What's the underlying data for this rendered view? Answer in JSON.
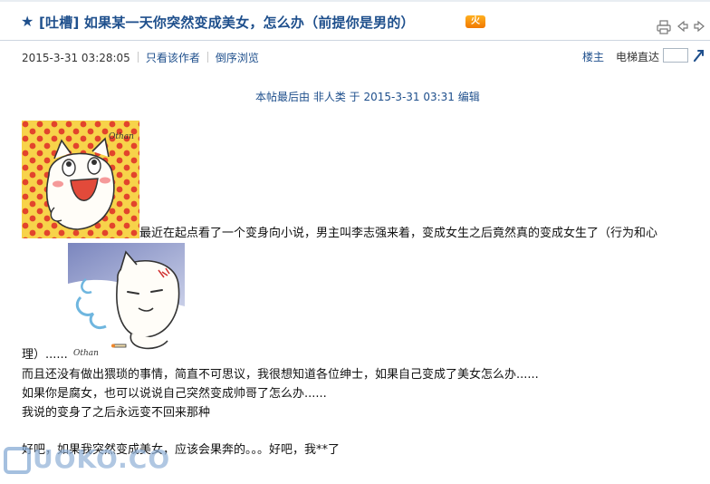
{
  "thread": {
    "title": "[吐槽] 如果某一天你突然变成美女，怎么办（前提你是男的）",
    "hot_badge": "火"
  },
  "toolbar": {
    "print_icon": "print-icon",
    "prev_icon": "arrow-left-icon",
    "next_icon": "arrow-right-icon"
  },
  "post_meta": {
    "timestamp": "2015-3-31 03:28:05",
    "only_author": "只看该作者",
    "reverse_view": "倒序浏览",
    "floor_label": "楼主",
    "jump_label": "电梯直达",
    "jump_value": ""
  },
  "edit_note": "本帖最后由 非人类 于 2015-3-31 03:31 编辑",
  "content": {
    "line1": "最近在起点看了一个变身向小说，男主叫李志强来着，变成女生之后竟然真的变成女生了（行为和心",
    "line2": "理）......",
    "line3": "而且还没有做出猥琐的事情，简直不可思议，我很想知道各位绅士，如果自己变成了美女怎么办......",
    "line4": "如果你是腐女，也可以说说自己突然变成帅哥了怎么办......",
    "line5": "我说的变身了之后永远变不回来那种",
    "line6": "好吧，如果我突然变成美女，应该会果奔的。。。好吧，我**了"
  },
  "images": {
    "emoji1_signature": "Othan",
    "emoji2_signature": "Othan"
  },
  "watermark": "UOKO.CO",
  "colors": {
    "link": "#1e4f8c",
    "polka_bg": "#f7d34a",
    "polka_dot": "#e2442c",
    "smoke_bg": "#9aa6cf"
  }
}
